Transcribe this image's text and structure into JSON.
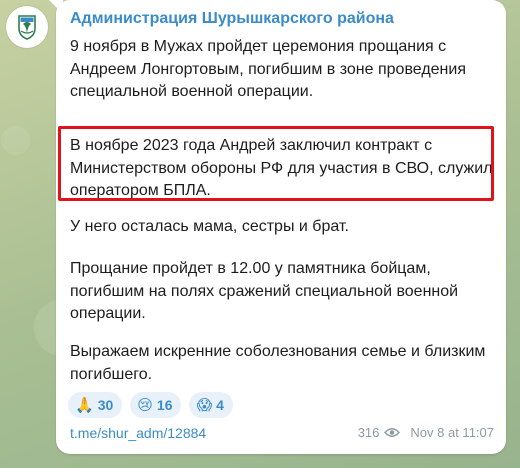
{
  "channel": {
    "name": "Администрация Шурышкарского района"
  },
  "message": {
    "paragraphs": [
      "9 ноября в Мужах пройдет церемония прощания с Андреем Лонгортовым, погибшим в зоне проведения специальной военной операции.",
      "В ноябре 2023 года Андрей заключил контракт с Министерством обороны РФ для участия в СВО, служил оператором БПЛА.",
      "У него осталась мама, сестры и брат.",
      "Прощание пройдет в 12.00 у памятника бойцам, погибшим на полях сражений специальной военной операции.",
      "Выражаем искренние соболезнования семье и близким погибшего."
    ],
    "link": "t.me/shur_adm/12884",
    "views": "316",
    "timestamp": "Nov 8 at 11:07"
  },
  "reactions": [
    {
      "emoji": "🙏",
      "icon": "praying-hands-icon",
      "count": "30"
    },
    {
      "emoji": "😢",
      "icon": "crying-face-icon",
      "count": "16"
    },
    {
      "emoji": "😱",
      "icon": "screaming-face-icon",
      "count": "4"
    }
  ],
  "colors": {
    "accent": "#3a8cc9",
    "highlight_border": "#e0121b",
    "meta": "#8c9aa6"
  }
}
